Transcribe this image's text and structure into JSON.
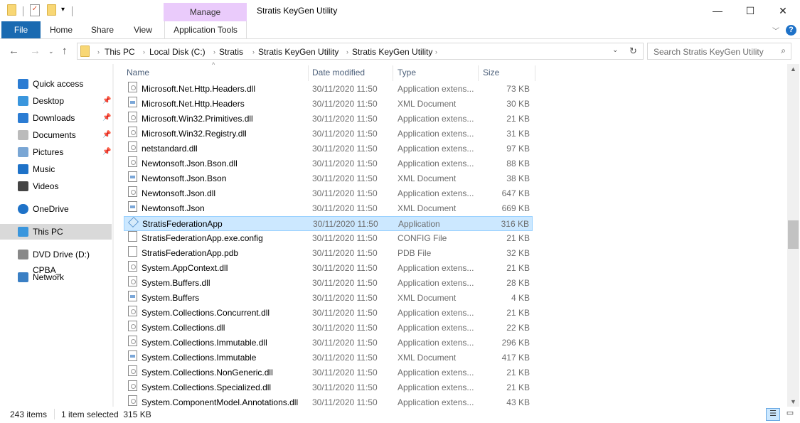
{
  "window": {
    "title": "Stratis KeyGen Utility",
    "context_tab": "Manage",
    "minimize": "—",
    "maximize": "☐",
    "close": "✕"
  },
  "ribbon": {
    "tabs": [
      "File",
      "Home",
      "Share",
      "View",
      "Application Tools"
    ]
  },
  "address": {
    "crumbs": [
      "This PC",
      "Local Disk (C:)",
      "Stratis",
      "Stratis KeyGen Utility",
      "Stratis KeyGen Utility"
    ]
  },
  "search": {
    "placeholder": "Search Stratis KeyGen Utility"
  },
  "sidebar": {
    "items": [
      {
        "label": "Quick access",
        "icon": "star-icon",
        "color": "#2b7cd3"
      },
      {
        "label": "Desktop",
        "icon": "desktop-icon",
        "color": "#3a96dd",
        "pinned": true
      },
      {
        "label": "Downloads",
        "icon": "download-icon",
        "color": "#2b7cd3",
        "pinned": true
      },
      {
        "label": "Documents",
        "icon": "documents-icon",
        "color": "#bbb",
        "pinned": true
      },
      {
        "label": "Pictures",
        "icon": "pictures-icon",
        "color": "#7aa6d4",
        "pinned": true
      },
      {
        "label": "Music",
        "icon": "music-icon",
        "color": "#1e72c8"
      },
      {
        "label": "Videos",
        "icon": "videos-icon",
        "color": "#444"
      },
      {
        "label": "OneDrive",
        "icon": "cloud-icon",
        "color": "#1e72c8"
      },
      {
        "label": "This PC",
        "icon": "computer-icon",
        "color": "#3a96dd",
        "selected": true
      },
      {
        "label": "DVD Drive (D:) CPBA_",
        "icon": "dvd-icon",
        "color": "#888"
      },
      {
        "label": "Network",
        "icon": "network-icon",
        "color": "#3a7fc4"
      }
    ]
  },
  "columns": [
    "Name",
    "Date modified",
    "Type",
    "Size"
  ],
  "files": [
    [
      "Microsoft.Net.Http.Headers.dll",
      "30/11/2020 11:50",
      "Application extens...",
      "73 KB",
      "dll"
    ],
    [
      "Microsoft.Net.Http.Headers",
      "30/11/2020 11:50",
      "XML Document",
      "30 KB",
      "xml"
    ],
    [
      "Microsoft.Win32.Primitives.dll",
      "30/11/2020 11:50",
      "Application extens...",
      "21 KB",
      "dll"
    ],
    [
      "Microsoft.Win32.Registry.dll",
      "30/11/2020 11:50",
      "Application extens...",
      "31 KB",
      "dll"
    ],
    [
      "netstandard.dll",
      "30/11/2020 11:50",
      "Application extens...",
      "97 KB",
      "dll"
    ],
    [
      "Newtonsoft.Json.Bson.dll",
      "30/11/2020 11:50",
      "Application extens...",
      "88 KB",
      "dll"
    ],
    [
      "Newtonsoft.Json.Bson",
      "30/11/2020 11:50",
      "XML Document",
      "38 KB",
      "xml"
    ],
    [
      "Newtonsoft.Json.dll",
      "30/11/2020 11:50",
      "Application extens...",
      "647 KB",
      "dll"
    ],
    [
      "Newtonsoft.Json",
      "30/11/2020 11:50",
      "XML Document",
      "669 KB",
      "xml"
    ],
    [
      "StratisFederationApp",
      "30/11/2020 11:50",
      "Application",
      "316 KB",
      "app"
    ],
    [
      "StratisFederationApp.exe.config",
      "30/11/2020 11:50",
      "CONFIG File",
      "21 KB",
      "file"
    ],
    [
      "StratisFederationApp.pdb",
      "30/11/2020 11:50",
      "PDB File",
      "32 KB",
      "file"
    ],
    [
      "System.AppContext.dll",
      "30/11/2020 11:50",
      "Application extens...",
      "21 KB",
      "dll"
    ],
    [
      "System.Buffers.dll",
      "30/11/2020 11:50",
      "Application extens...",
      "28 KB",
      "dll"
    ],
    [
      "System.Buffers",
      "30/11/2020 11:50",
      "XML Document",
      "4 KB",
      "xml"
    ],
    [
      "System.Collections.Concurrent.dll",
      "30/11/2020 11:50",
      "Application extens...",
      "21 KB",
      "dll"
    ],
    [
      "System.Collections.dll",
      "30/11/2020 11:50",
      "Application extens...",
      "22 KB",
      "dll"
    ],
    [
      "System.Collections.Immutable.dll",
      "30/11/2020 11:50",
      "Application extens...",
      "296 KB",
      "dll"
    ],
    [
      "System.Collections.Immutable",
      "30/11/2020 11:50",
      "XML Document",
      "417 KB",
      "xml"
    ],
    [
      "System.Collections.NonGeneric.dll",
      "30/11/2020 11:50",
      "Application extens...",
      "21 KB",
      "dll"
    ],
    [
      "System.Collections.Specialized.dll",
      "30/11/2020 11:50",
      "Application extens...",
      "21 KB",
      "dll"
    ],
    [
      "System.ComponentModel.Annotations.dll",
      "30/11/2020 11:50",
      "Application extens...",
      "43 KB",
      "dll"
    ]
  ],
  "selected_index": 9,
  "status": {
    "count": "243 items",
    "selection": "1 item selected  315 KB"
  }
}
